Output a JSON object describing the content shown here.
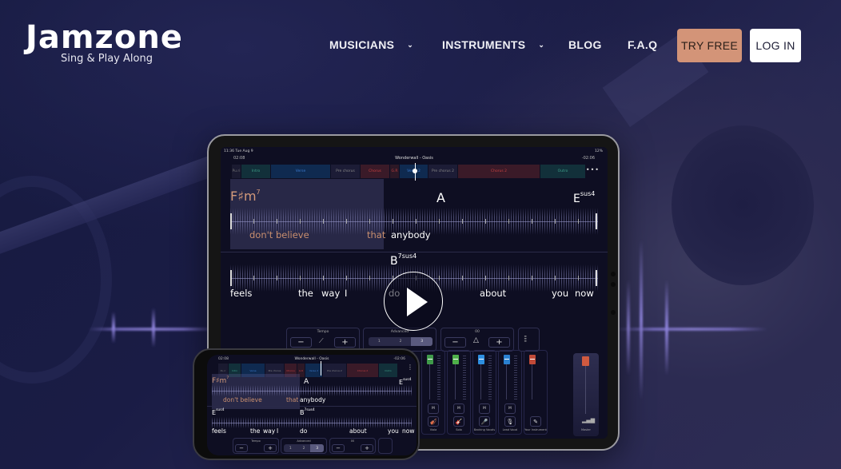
{
  "brand": {
    "name": "Jamzone",
    "tagline": "Sing & Play Along"
  },
  "nav": {
    "items": [
      {
        "label": "MUSICIANS",
        "has_dropdown": true
      },
      {
        "label": "INSTRUMENTS",
        "has_dropdown": true
      },
      {
        "label": "BLOG",
        "has_dropdown": false
      },
      {
        "label": "F.A.Q",
        "has_dropdown": false
      }
    ],
    "try_free": "TRY FREE",
    "log_in": "LOG IN",
    "chevron_glyph": "⌄"
  },
  "colors": {
    "accent": "#d39478",
    "background": "#1a1c45",
    "lyric_past": "#c98f6f"
  },
  "app": {
    "status_time": "11:36  Tue Aug 9",
    "status_battery": "12%",
    "elapsed": "02:08",
    "remaining": "-02:06",
    "song_title": "Wonderwall - Oasis",
    "more_glyph": "•••",
    "sections": [
      {
        "label": "Pu.ri",
        "color": "#1a1a30",
        "text": "#777"
      },
      {
        "label": "Intro",
        "color": "#12303a",
        "text": "#3ea08a"
      },
      {
        "label": "Verse",
        "color": "#0f2a50",
        "text": "#3a7ad0"
      },
      {
        "label": "Pre chorus",
        "color": "#1c1c36",
        "text": "#888"
      },
      {
        "label": "Chorus",
        "color": "#3a1a28",
        "text": "#c84040"
      },
      {
        "label": "G.R",
        "color": "#2c1826",
        "text": "#c04040"
      },
      {
        "label": "Verse 2",
        "color": "#0f2a50",
        "text": "#3a7ad0"
      },
      {
        "label": "Pre chorus 2",
        "color": "#1c1c36",
        "text": "#888"
      },
      {
        "label": "Chorus 2",
        "color": "#3a1a28",
        "text": "#c84040"
      },
      {
        "label": "Outro",
        "color": "#12303a",
        "text": "#3ea08a"
      }
    ],
    "line1": {
      "chords": [
        {
          "root": "F♯m",
          "ext": "7",
          "past": true
        },
        {
          "root": "A",
          "ext": "",
          "past": false
        },
        {
          "root": "E",
          "ext": "sus4",
          "past": false
        }
      ],
      "lyrics": [
        {
          "text": "don't believe",
          "past": true
        },
        {
          "text": "that",
          "past": true
        },
        {
          "text": "anybody",
          "past": false
        }
      ]
    },
    "line2": {
      "chords": [
        {
          "root": "E",
          "ext": "sus4"
        },
        {
          "root": "B",
          "ext": "7sus4"
        }
      ],
      "lyrics": [
        "feels",
        "the",
        "way",
        "I",
        "do",
        "about",
        "you",
        "now"
      ]
    },
    "controls": {
      "tempo_label": "Tempo",
      "difficulty_label": "Advanced",
      "difficulty_levels": [
        "1",
        "2",
        "3"
      ],
      "difficulty_selected": 3,
      "metronome_label": "00",
      "minus": "−",
      "plus": "+"
    },
    "mixer": {
      "channels": [
        {
          "name": "Viola",
          "color": "#3f9a4a",
          "mute": "M",
          "icon": "🎻"
        },
        {
          "name": "Solo",
          "color": "#4fb04a",
          "mute": "M",
          "icon": "🎸"
        },
        {
          "name": "Backing Vocals",
          "color": "#2e8fe0",
          "mute": "M",
          "icon": "🎤"
        },
        {
          "name": "Lead Vocal",
          "color": "#2a80d0",
          "mute": "M",
          "icon": "🎙"
        },
        {
          "name": "Your Instrument",
          "color": "#c04a38",
          "mute": "",
          "icon": "✎"
        }
      ],
      "master": {
        "name": "Master",
        "color": "#d05a40"
      }
    }
  }
}
